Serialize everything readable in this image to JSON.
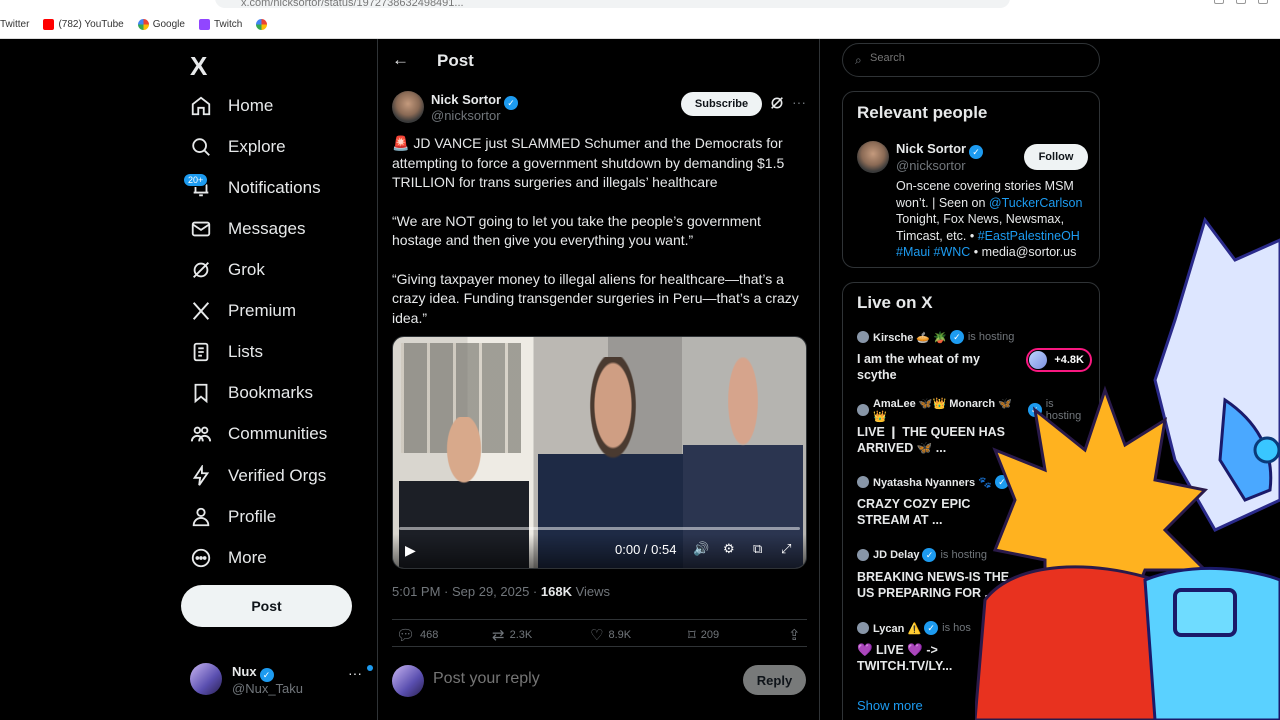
{
  "browser": {
    "url": "x.com/nicksortor/status/1972738632498491...",
    "bookmarks": [
      {
        "label": "Twitter",
        "color": "#1d9bf0"
      },
      {
        "label": "(782) YouTube",
        "color": "#ff0000"
      },
      {
        "label": "Google",
        "color": "#4285f4"
      },
      {
        "label": "Twitch",
        "color": "#9146ff"
      },
      {
        "label": "",
        "color": "#4285f4"
      }
    ]
  },
  "nav": {
    "logo": "X",
    "items": [
      {
        "label": "Home",
        "icon": "home-icon"
      },
      {
        "label": "Explore",
        "icon": "search-icon"
      },
      {
        "label": "Notifications",
        "icon": "bell-icon",
        "badge": "20+"
      },
      {
        "label": "Messages",
        "icon": "mail-icon"
      },
      {
        "label": "Grok",
        "icon": "grok-icon"
      },
      {
        "label": "Premium",
        "icon": "x-icon"
      },
      {
        "label": "Lists",
        "icon": "list-icon"
      },
      {
        "label": "Bookmarks",
        "icon": "bookmark-icon"
      },
      {
        "label": "Communities",
        "icon": "people-icon"
      },
      {
        "label": "Verified Orgs",
        "icon": "lightning-icon"
      },
      {
        "label": "Profile",
        "icon": "person-icon"
      },
      {
        "label": "More",
        "icon": "more-circle-icon"
      }
    ],
    "post_label": "Post",
    "user": {
      "name": "Nux",
      "handle": "@Nux_Taku",
      "menu": "···"
    }
  },
  "post": {
    "header_title": "Post",
    "back": "←",
    "author": {
      "name": "Nick Sortor",
      "handle": "@nicksortor"
    },
    "subscribe_label": "Subscribe",
    "more": "···",
    "paragraphs": [
      "🚨 JD VANCE just SLAMMED Schumer and the Democrats for attempting to force a government shutdown by demanding $1.5 TRILLION for trans surgeries and illegals’ healthcare",
      "“We are NOT going to let you take the people’s government hostage and then give you everything you want.”",
      "“Giving taxpayer money to illegal aliens for healthcare—that’s a crazy idea. Funding transgender surgeries in Peru—that’s a crazy idea.”"
    ],
    "video": {
      "time": "0:00 / 0:54",
      "progress": 0
    },
    "timestamp": "5:01 PM · Sep 29, 2025 ·",
    "views_count": "168K",
    "views_label": "Views",
    "actions": {
      "replies": "468",
      "reposts": "2.3K",
      "likes": "8.9K",
      "bookmarks": "209"
    },
    "reply_placeholder": "Post your reply",
    "reply_button": "Reply"
  },
  "sidebar": {
    "search_placeholder": "Search",
    "relevant": {
      "title": "Relevant people",
      "name": "Nick Sortor",
      "handle": "@nicksortor",
      "follow_label": "Follow",
      "bio_part1": "On-scene covering stories MSM won’t. | Seen on ",
      "bio_link1": "@TuckerCarlson",
      "bio_part2": " Tonight, Fox News, Newsmax, Timcast, etc. • ",
      "bio_link2": "#EastPalestineOH #Maui #WNC",
      "bio_part3": " • media@sortor.us"
    },
    "live": {
      "title": "Live on X",
      "items": [
        {
          "host": "Kirsche 🥧 🪴",
          "status": "is hosting",
          "title": "I am the wheat of my scythe",
          "badge": "+4.8K"
        },
        {
          "host": "AmaLee 🦋👑 Monarch 🦋👑",
          "status": "is hosting",
          "title": "LIVE ❙ THE QUEEN HAS ARRIVED 🦋 ...",
          "badge": ""
        },
        {
          "host": "Nyatasha Nyanners 🐾",
          "status": "",
          "title": "CRAZY COZY EPIC STREAM AT ...",
          "badge": ""
        },
        {
          "host": "JD Delay",
          "status": "is hosting",
          "title": "BREAKING NEWS-IS THE US PREPARING FOR ...",
          "badge": ""
        },
        {
          "host": "Lycan ⚠️",
          "status": "is hos",
          "title": "💜 LIVE 💜 -> TWITCH.TV/LY...",
          "badge": ""
        }
      ],
      "show_more": "Show more"
    }
  },
  "colors": {
    "accent": "#1d9bf0",
    "background": "#000000",
    "border": "#2f3336",
    "muted": "#71767b"
  }
}
